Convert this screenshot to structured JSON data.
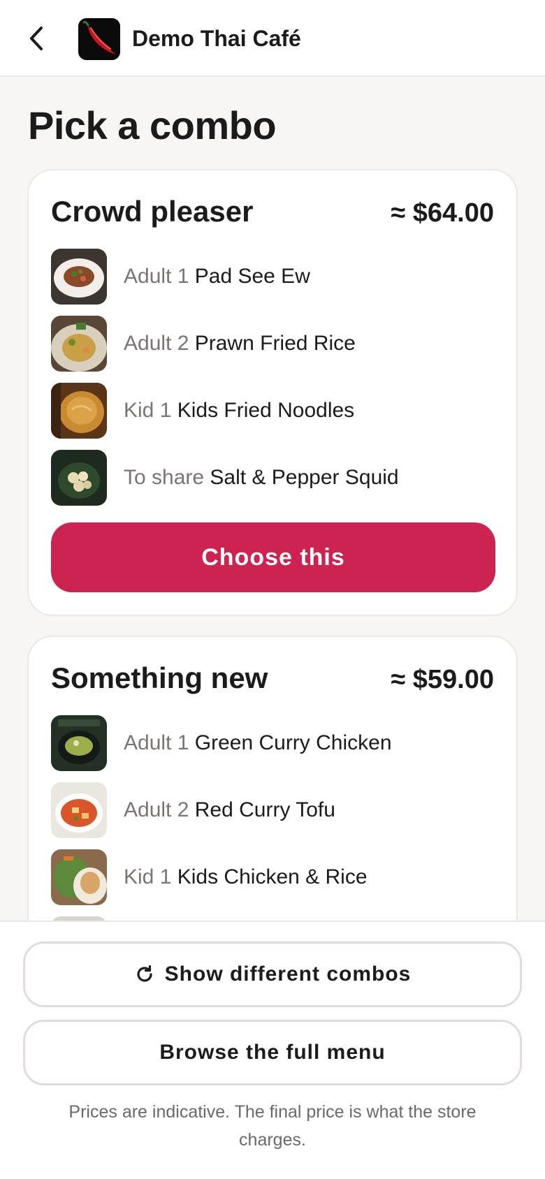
{
  "header": {
    "back_icon": "chevron-left-icon",
    "logo_icon": "chili-pepper-icon",
    "store_name": "Demo Thai Café"
  },
  "page": {
    "title": "Pick a combo"
  },
  "combos": [
    {
      "title": "Crowd pleaser",
      "price": "≈ $64.00",
      "items": [
        {
          "role": "Adult 1",
          "dish": "Pad See Ew"
        },
        {
          "role": "Adult 2",
          "dish": "Prawn Fried Rice"
        },
        {
          "role": "Kid 1",
          "dish": "Kids Fried Noodles"
        },
        {
          "role": "To share",
          "dish": "Salt & Pepper Squid"
        }
      ],
      "button_label": "Choose this"
    },
    {
      "title": "Something new",
      "price": "≈ $59.00",
      "items": [
        {
          "role": "Adult 1",
          "dish": "Green Curry Chicken"
        },
        {
          "role": "Adult 2",
          "dish": "Red Curry Tofu"
        },
        {
          "role": "Kid 1",
          "dish": "Kids Chicken & Rice"
        }
      ]
    }
  ],
  "footer": {
    "show_different_label": "Show different combos",
    "show_different_icon": "refresh-icon",
    "browse_menu_label": "Browse the full menu",
    "disclaimer": "Prices are indicative. The final price is what the store charges."
  },
  "colors": {
    "accent": "#cc2350",
    "background": "#f7f6f4",
    "card": "#ffffff",
    "muted_text": "#7a7472"
  }
}
